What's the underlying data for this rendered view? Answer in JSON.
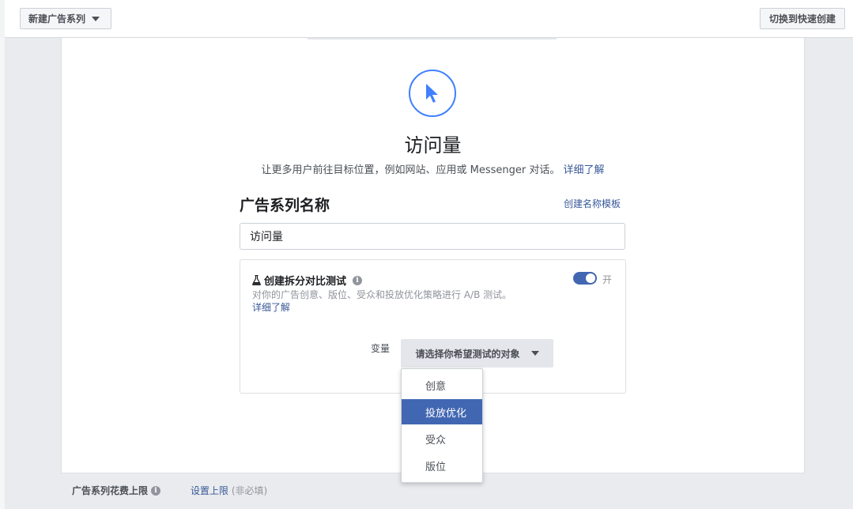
{
  "header": {
    "new_campaign_label": "新建广告系列",
    "quick_create_label": "切换到快速创建"
  },
  "objective": {
    "icon": "cursor-arrow-icon",
    "title": "访问量",
    "description": "让更多用户前往目标位置，例如网站、应用或 Messenger 对话。",
    "learn_more": "详细了解"
  },
  "campaign_name": {
    "section_title": "广告系列名称",
    "template_link": "创建名称模板",
    "value": "访问量"
  },
  "split_test": {
    "title": "创建拆分对比测试",
    "info": "i",
    "description": "对你的广告创意、版位、受众和投放优化策略进行 A/B 测试。",
    "learn_more": "详细了解",
    "toggle_label": "开",
    "toggle_on": true,
    "variable_label": "变量",
    "variable_placeholder": "请选择你希望测试的对象",
    "options": [
      "创意",
      "投放优化",
      "受众",
      "版位"
    ],
    "selected_option": "投放优化"
  },
  "budget": {
    "label": "广告系列花费上限",
    "info": "i",
    "set_limit": "设置上限",
    "optional": "(非必填)"
  },
  "colors": {
    "accent": "#4267b2",
    "link": "#385898",
    "objective_ring": "#4080ff"
  }
}
